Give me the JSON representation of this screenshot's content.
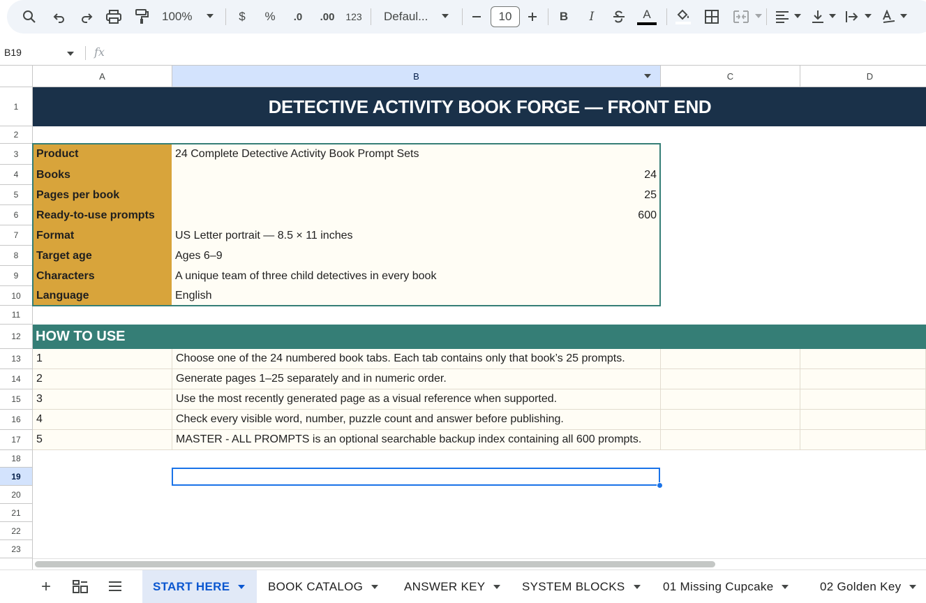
{
  "toolbar": {
    "zoom": "100%",
    "currency_label": "$",
    "percent_label": "%",
    "dec_decrease_label": ".0",
    "dec_increase_label": ".00",
    "more_formats_label": "123",
    "font_name": "Defaul...",
    "font_size": "10",
    "bold_label": "B",
    "italic_label": "I",
    "text_color_label": "A"
  },
  "formula_bar": {
    "name_box": "B19",
    "fx_label": "fx",
    "formula": ""
  },
  "grid": {
    "columns": [
      "A",
      "B",
      "C",
      "D"
    ],
    "rows": [
      "1",
      "2",
      "3",
      "4",
      "5",
      "6",
      "7",
      "8",
      "9",
      "10",
      "11",
      "12",
      "13",
      "14",
      "15",
      "16",
      "17",
      "18",
      "19",
      "20",
      "21",
      "22",
      "23"
    ],
    "title": "DETECTIVE ACTIVITY BOOK FORGE — FRONT END",
    "info": [
      {
        "label": "Product",
        "value": "24 Complete Detective Activity Book Prompt Sets"
      },
      {
        "label": "Books",
        "value": "24"
      },
      {
        "label": "Pages per book",
        "value": "25"
      },
      {
        "label": "Ready-to-use prompts",
        "value": "600"
      },
      {
        "label": "Format",
        "value": "US Letter portrait — 8.5 × 11 inches"
      },
      {
        "label": "Target age",
        "value": "Ages 6–9"
      },
      {
        "label": "Characters",
        "value": "A unique team of three child detectives in every book"
      },
      {
        "label": "Language",
        "value": "English"
      }
    ],
    "howto_header": "HOW TO USE",
    "steps": [
      {
        "num": "1",
        "text": "Choose one of the 24 numbered book tabs. Each tab contains only that book’s 25 prompts."
      },
      {
        "num": "2",
        "text": "Generate pages 1–25 separately and in numeric order."
      },
      {
        "num": "3",
        "text": "Use the most recently generated page as a visual reference when supported."
      },
      {
        "num": "4",
        "text": "Check every visible word, number, puzzle count and answer before publishing."
      },
      {
        "num": "5",
        "text": "MASTER - ALL PROMPTS is an optional searchable backup index containing all 600 prompts."
      }
    ],
    "selected_cell": "B19"
  },
  "sheet_tabs": {
    "add_label": "+",
    "tabs": [
      {
        "label": "START HERE",
        "active": true
      },
      {
        "label": "BOOK CATALOG",
        "active": false
      },
      {
        "label": "ANSWER KEY",
        "active": false
      },
      {
        "label": "SYSTEM BLOCKS",
        "active": false
      },
      {
        "label": "01 Missing Cupcake",
        "active": false
      },
      {
        "label": "02 Golden Key",
        "active": false
      }
    ]
  },
  "colors": {
    "title_bg": "#1a3149",
    "label_bg": "#d8a43b",
    "value_bg": "#fffdf5",
    "section_bg": "#357e76",
    "accent": "#0b57d0",
    "selected_header": "#d3e3fd"
  }
}
